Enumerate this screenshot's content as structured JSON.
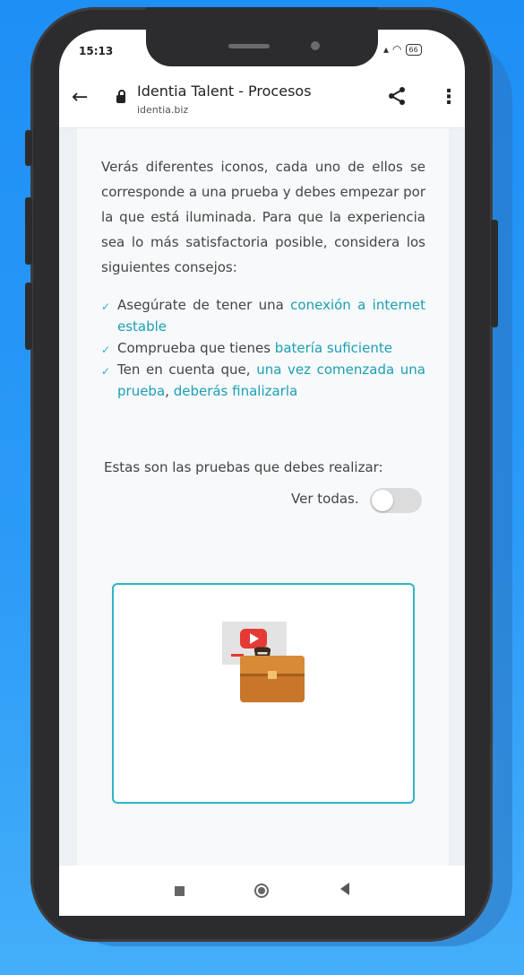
{
  "status": {
    "time": "15:13",
    "battery": "66"
  },
  "browser": {
    "title": "Identia Talent - Procesos",
    "domain": "identia.biz"
  },
  "content": {
    "intro": "Verás diferentes iconos, cada uno de ellos se corresponde a una prueba y debes empezar por la que está iluminada. Para que la experiencia sea lo más satisfactoria posible, considera los siguientes consejos:",
    "tips": [
      {
        "pre": "Asegúrate de tener una ",
        "highlight": "conexión a internet estable",
        "post": ""
      },
      {
        "pre": "Comprueba que tienes ",
        "highlight": "batería suficiente",
        "post": ""
      },
      {
        "pre": "Ten en cuenta que, ",
        "highlight": "una vez comenzada una prueba",
        "mid": ", ",
        "highlight2": "deberás finalizarla",
        "post": ""
      }
    ],
    "pruebas_label": "Estas son las pruebas que debes realizar:",
    "ver_todas_label": "Ver todas.",
    "ver_todas_on": false
  },
  "colors": {
    "accent": "#1a9fb3",
    "card_border": "#2fb4c6",
    "background": "#1e8ff5"
  },
  "icons": [
    "back-arrow-icon",
    "lock-icon",
    "share-icon",
    "more-vert-icon",
    "check-icon",
    "video-briefcase-icon",
    "nav-recents-icon",
    "nav-home-icon",
    "nav-back-icon"
  ]
}
